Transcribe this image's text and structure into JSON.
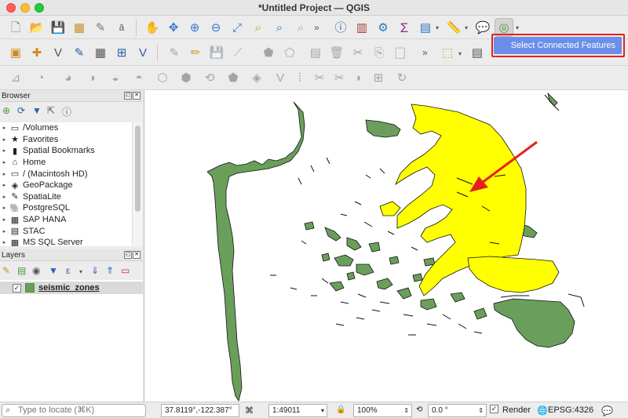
{
  "window": {
    "title": "*Untitled Project — QGIS"
  },
  "toolbar": {
    "more_glyph": "»",
    "popup_label": "Select Connected Features"
  },
  "browser": {
    "title": "Browser",
    "items": [
      {
        "label": "/Volumes",
        "icon": "folder-icon",
        "glyph": "▭"
      },
      {
        "label": "Favorites",
        "icon": "star-icon",
        "glyph": "★"
      },
      {
        "label": "Spatial Bookmarks",
        "icon": "bookmark-icon",
        "glyph": "▮"
      },
      {
        "label": "Home",
        "icon": "home-folder-icon",
        "glyph": "⌂"
      },
      {
        "label": "/ (Macintosh HD)",
        "icon": "folder-icon",
        "glyph": "▭"
      },
      {
        "label": "GeoPackage",
        "icon": "geopackage-icon",
        "glyph": "◈"
      },
      {
        "label": "SpatiaLite",
        "icon": "feather-icon",
        "glyph": "✎"
      },
      {
        "label": "PostgreSQL",
        "icon": "elephant-icon",
        "glyph": "🐘"
      },
      {
        "label": "SAP HANA",
        "icon": "database-icon",
        "glyph": "▦"
      },
      {
        "label": "STAC",
        "icon": "stac-icon",
        "glyph": "▤"
      },
      {
        "label": "MS SQL Server",
        "icon": "database-icon",
        "glyph": "▦"
      }
    ]
  },
  "layers": {
    "title": "Layers",
    "items": [
      {
        "name": "seismic_zones",
        "checked": true,
        "color": "#6a9f5b"
      }
    ]
  },
  "colors": {
    "zone_green": "#6a9f5b",
    "zone_yellow": "#ffff00",
    "highlight_red": "#e5201b",
    "popup_blue": "#6b8ee8"
  },
  "statusbar": {
    "locate_placeholder": "Type to locate (⌘K)",
    "coordinate": "37.8119°,-122.387°",
    "scale": "1:49011",
    "magnifier": "100%",
    "rotation": "0.0 °",
    "render_label": "Render",
    "crs": "EPSG:4326"
  }
}
